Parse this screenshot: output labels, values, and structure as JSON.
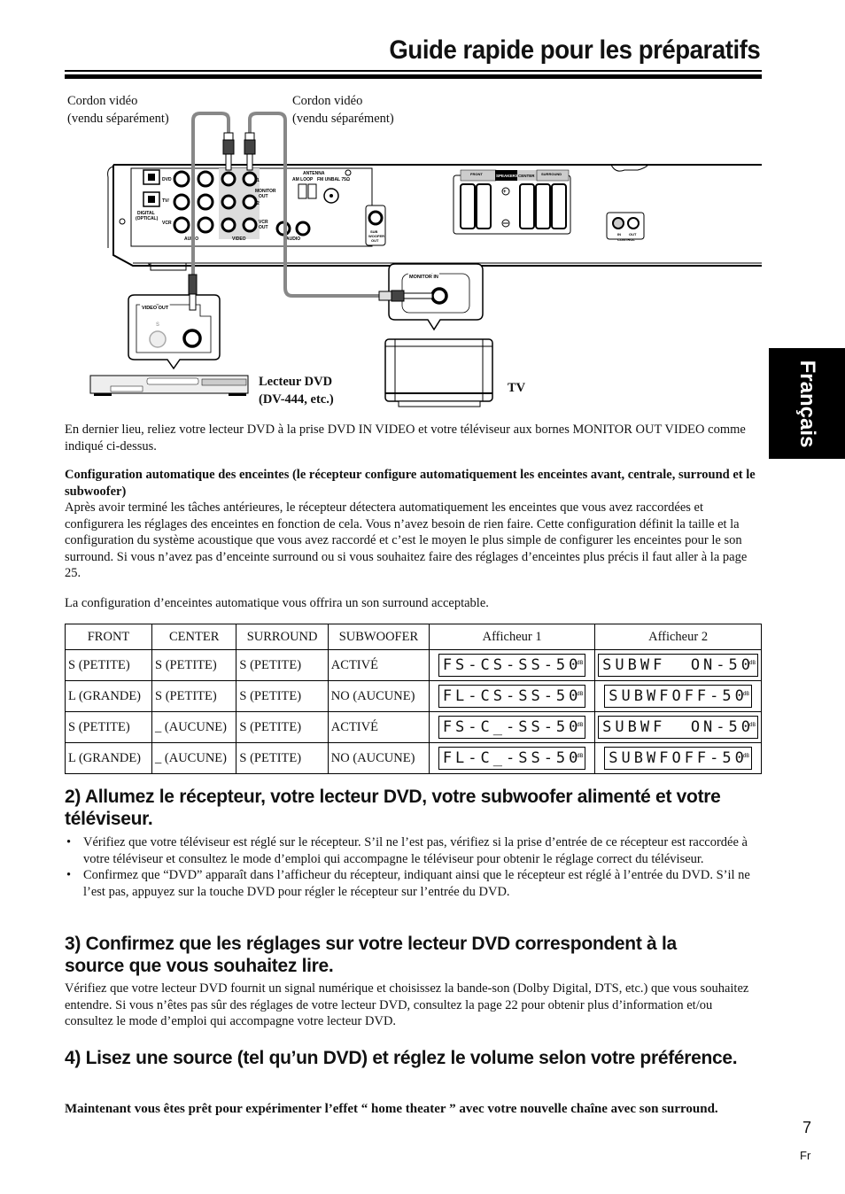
{
  "page": {
    "title": "Guide rapide pour les préparatifs",
    "language_tab": "Français",
    "page_number": "7",
    "page_lang": "Fr"
  },
  "diagram": {
    "cable_label_left": [
      "Cordon vidéo",
      "(vendu séparément)"
    ],
    "cable_label_right": [
      "Cordon vidéo",
      "(vendu séparément)"
    ],
    "dvd_label": [
      "Lecteur DVD",
      "(DV-444, etc.)"
    ],
    "tv_label": "TV",
    "jack_labels": {
      "dvd_in": "DVD IN",
      "tv_sat_in": "TV/ SAT IN",
      "vcr_in": "VCR IN",
      "digital_optical": "DIGITAL (OPTICAL)",
      "audio": "AUDIO",
      "video": "VIDEO",
      "monitor_out": "MONITOR OUT",
      "vcr_out": "VCR OUT",
      "antenna": "ANTENNA",
      "am_loop": "AM LOOP",
      "fm_unbal": "FM UNBAL 75Ω",
      "sub_woofer_out": "SUB WOOFER OUT",
      "front": "FRONT",
      "speakers": "SPEAKERS",
      "center": "CENTER",
      "surround": "SURROUND",
      "control": "CONTROL",
      "control_in": "IN",
      "control_out": "OUT",
      "monitor_in": "MONITOR IN",
      "video_out": "VIDEO OUT",
      "s": "S",
      "r": "R",
      "l": "L",
      "one": "1",
      "two": "2"
    }
  },
  "intro": {
    "paragraph": "En dernier lieu, reliez votre lecteur DVD à la prise DVD IN VIDEO et votre téléviseur aux bornes MONITOR OUT VIDEO comme indiqué ci-dessus."
  },
  "auto_config": {
    "heading": "Configuration automatique des enceintes (le récepteur configure automatiquement les enceintes avant, centrale, surround et le subwoofer)",
    "body": "Après avoir terminé les tâches antérieures, le récepteur détectera automatiquement les enceintes que vous avez raccordées et configurera les réglages des enceintes en fonction de cela. Vous n’avez besoin de rien faire. Cette configuration définit la taille et la configuration du système acoustique que vous avez raccordé et c’est le moyen le plus simple de configurer les enceintes pour le son surround. Si vous n’avez pas d’enceinte surround ou si vous souhaitez faire des réglages d’enceintes plus précis il faut aller à la page 25.",
    "note": "La configuration d’enceintes automatique vous offrira un son surround acceptable."
  },
  "table": {
    "headers": [
      "FRONT",
      "CENTER",
      "SURROUND",
      "SUBWOOFER",
      "Afficheur 1",
      "Afficheur 2"
    ],
    "lcd_unit": "dB",
    "rows": [
      [
        "S (PETITE)",
        "S (PETITE)",
        "S (PETITE)",
        "ACTIVÉ",
        "FS-CS-SS-50",
        "SUBWF  ON-50"
      ],
      [
        "L (GRANDE)",
        "S (PETITE)",
        "S (PETITE)",
        "NO (AUCUNE)",
        "FL-CS-SS-50",
        "SUBWFOFF-50"
      ],
      [
        "S (PETITE)",
        "_ (AUCUNE)",
        "S (PETITE)",
        "ACTIVÉ",
        "FS-C_-SS-50",
        "SUBWF  ON-50"
      ],
      [
        "L (GRANDE)",
        "_ (AUCUNE)",
        "S (PETITE)",
        "NO (AUCUNE)",
        "FL-C_-SS-50",
        "SUBWFOFF-50"
      ]
    ]
  },
  "step2": {
    "heading": "2) Allumez le récepteur, votre lecteur DVD, votre subwoofer alimenté et votre téléviseur.",
    "bullets": [
      "Vérifiez que votre téléviseur est réglé sur le récepteur. S’il ne l’est pas, vérifiez si la prise d’entrée de ce récepteur est raccordée à votre téléviseur et consultez le mode d’emploi qui accompagne le téléviseur pour obtenir le réglage correct du téléviseur.",
      "Confirmez que “DVD” apparaît dans l’afficheur du récepteur, indiquant ainsi que le récepteur est réglé à l’entrée du DVD. S’il ne l’est pas, appuyez sur la touche DVD pour régler le récepteur sur l’entrée du DVD."
    ]
  },
  "step3": {
    "heading": "3) Confirmez que les réglages sur votre lecteur DVD correspondent à la source que vous souhaitez lire.",
    "body": "Vérifiez que votre lecteur DVD fournit un signal numérique et choisissez la bande-son (Dolby Digital, DTS, etc.) que vous souhaitez entendre. Si vous n’êtes pas sûr des réglages de votre lecteur DVD, consultez la page 22 pour obtenir plus d’information et/ou consultez le mode d’emploi qui accompagne votre lecteur DVD."
  },
  "step4": {
    "heading": "4) Lisez une source (tel qu’un DVD) et réglez le volume selon votre préférence.",
    "closing": "Maintenant vous êtes prêt pour expérimenter l’effet “ home theater ” avec votre nouvelle chaîne avec son surround."
  }
}
